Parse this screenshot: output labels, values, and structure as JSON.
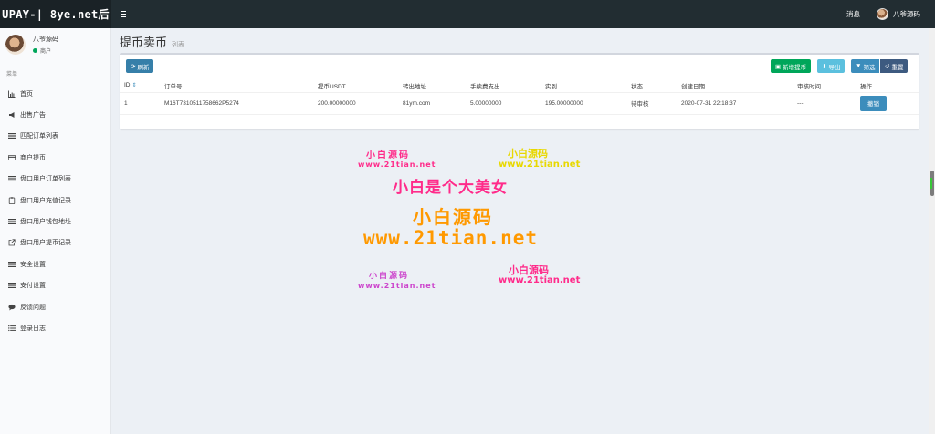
{
  "header": {
    "brand": "UPAY-| 8ye.net后",
    "messages": "消息",
    "username": "八爷源码"
  },
  "sidebar": {
    "user_name": "八爷源码",
    "user_role": "商户",
    "menu_header": "菜单",
    "items": [
      {
        "label": "首页",
        "icon": "bar-chart-icon"
      },
      {
        "label": "出售广告",
        "icon": "bullhorn-icon"
      },
      {
        "label": "匹配订单列表",
        "icon": "list-icon"
      },
      {
        "label": "商户提币",
        "icon": "credit-card-icon"
      },
      {
        "label": "盘口用户订单列表",
        "icon": "list-icon"
      },
      {
        "label": "盘口用户充值记录",
        "icon": "clipboard-icon"
      },
      {
        "label": "盘口用户钱包地址",
        "icon": "list-icon"
      },
      {
        "label": "盘口用户提币记录",
        "icon": "external-link-icon"
      },
      {
        "label": "安全设置",
        "icon": "list-icon"
      },
      {
        "label": "支付设置",
        "icon": "list-icon"
      },
      {
        "label": "反馈问题",
        "icon": "comment-icon"
      },
      {
        "label": "登录日志",
        "icon": "list-ul-icon"
      }
    ]
  },
  "page": {
    "title": "提币卖币",
    "subtitle": "列表"
  },
  "toolbar": {
    "refresh": "刷新",
    "add": "新增提币",
    "export": "导出",
    "filter": "筛选",
    "reset": "重置"
  },
  "table": {
    "columns": [
      "ID",
      "订单号",
      "提币USDT",
      "转出地址",
      "手续费支出",
      "实到",
      "状态",
      "创建日期",
      "审核时间",
      "操作"
    ],
    "rows": [
      {
        "id": "1",
        "order_no": "M16T7310511758662P5274",
        "usdt": "200.00000000",
        "address": "81ym.com",
        "fee": "5.00000000",
        "actual": "195.00000000",
        "status": "待审核",
        "created": "2020-07-31 22:18:37",
        "reviewed": "---",
        "action": "撤销"
      }
    ]
  },
  "watermark": {
    "line1": "小白源码",
    "url1": "www.21tian.net",
    "line2": "小白源码",
    "url2": "www.21tian.net",
    "slogan": "小白是个大美女",
    "line3": "小白源码",
    "url3": "www.21tian.net",
    "line4": "小白源码",
    "url4": "www.21tian.net",
    "line5": "小白源码",
    "url5": "www.21tian.net"
  },
  "colors": {
    "topbar": "#222d32",
    "primary": "#3c8dbc",
    "success": "#00a65a",
    "info": "#5bc0de"
  }
}
